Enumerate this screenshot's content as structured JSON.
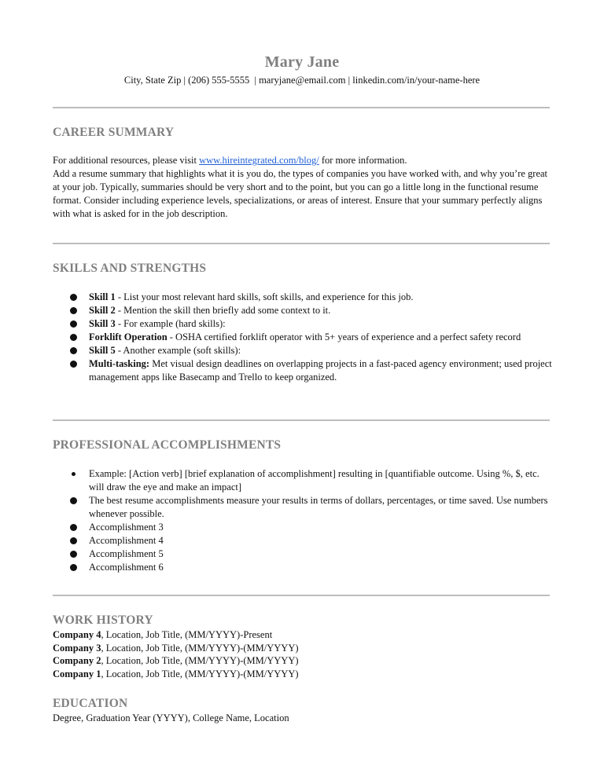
{
  "header": {
    "name": "Mary Jane",
    "contact": "City, State Zip | (206) 555-5555  | maryjane@email.com | linkedin.com/in/your-name-here"
  },
  "career_summary": {
    "heading": "CAREER SUMMARY",
    "resources_prefix": "For additional resources, please visit ",
    "resources_link": "www.hireintegrated.com/blog/",
    "resources_suffix": " for more information.",
    "summary": "Add a resume summary that highlights what it is you do, the types of companies you have worked with, and why you’re great at your job. Typically, summaries should be very short and to the point, but you can go a little long in the functional resume format. Consider including experience levels, specializations, or areas of interest. Ensure that your summary perfectly aligns with what is asked for in the job description."
  },
  "skills": {
    "heading": "SKILLS AND STRENGTHS",
    "items": [
      {
        "label": "Skill 1",
        "text": " - List your most relevant hard skills, soft skills, and experience for this job."
      },
      {
        "label": "Skill 2",
        "text": " - Mention the skill then briefly add some context to it."
      },
      {
        "label": "Skill 3",
        "text": " - For example (hard skills):"
      },
      {
        "label": "Forklift Operation",
        "text": " - OSHA certified forklift operator with 5+ years of experience and a perfect safety record"
      },
      {
        "label": "Skill 5",
        "text": " - Another example (soft skills):"
      },
      {
        "label": "Multi-tasking:",
        "text": " Met visual design deadlines on overlapping projects in a fast-paced agency environment; used project management apps like Basecamp and Trello to keep organized."
      }
    ]
  },
  "accomplishments": {
    "heading": "PROFESSIONAL ACCOMPLISHMENTS",
    "items": [
      "Example: [Action verb] [brief explanation of accomplishment] resulting in [quantifiable outcome. Using %, $, etc. will draw the eye and make an impact]",
      "The best resume accomplishments measure your results in terms of dollars, percentages, or time saved. Use numbers whenever possible.",
      "Accomplishment 3",
      "Accomplishment 4",
      "Accomplishment 5",
      "Accomplishment 6"
    ]
  },
  "work_history": {
    "heading": "WORK HISTORY",
    "entries": [
      {
        "company": "Company 4",
        "details": ", Location, Job Title, (MM/YYYY)-Present"
      },
      {
        "company": "Company 3",
        "details": ", Location, Job Title, (MM/YYYY)-(MM/YYYY)"
      },
      {
        "company": "Company 2",
        "details": ", Location, Job Title, (MM/YYYY)-(MM/YYYY)"
      },
      {
        "company": "Company 1",
        "details": ", Location, Job Title, (MM/YYYY)-(MM/YYYY)"
      }
    ]
  },
  "education": {
    "heading": "EDUCATION",
    "entry": "Degree, Graduation Year (YYYY), College Name, Location"
  },
  "colors": {
    "heading": "#7f7f7f",
    "rule": "#bdbdbd",
    "link": "#1f5fd6",
    "text": "#111111"
  }
}
